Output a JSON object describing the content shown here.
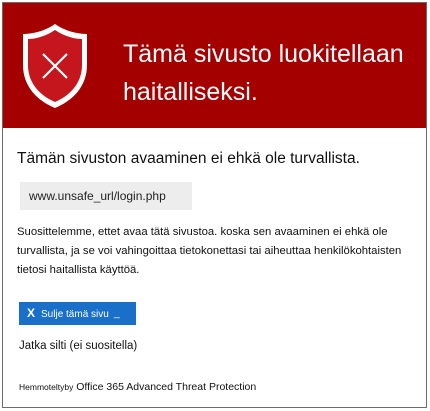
{
  "header": {
    "title": "Tämä sivusto luokitellaan haitalliseksi.",
    "background_color": "#a50000",
    "icon": "shield-x-icon"
  },
  "main": {
    "subtitle": "Tämän sivuston avaaminen ei ehkä ole turvallista.",
    "url": "www.unsafe_url/login.php",
    "description": "Suosittelemme, ettet avaa tätä sivustoa. koska sen avaaminen ei ehkä ole turvallista, ja se voi vahingoittaa tietokonettasi tai aiheuttaa henkilökohtaisten tietosi haitallista käyttöä.",
    "close_button_label": "Sulje tämä sivu",
    "close_button_icon": "x-icon",
    "close_button_color": "#1a6fc9",
    "continue_link": "Jatka silti (ei suositella)"
  },
  "footer": {
    "protected_by": "Hemmotelty",
    "by_word": "by",
    "product": "Office 365 Advanced Threat Protection"
  }
}
